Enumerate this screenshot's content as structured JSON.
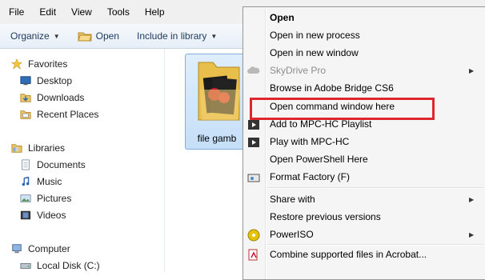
{
  "menubar": {
    "items": [
      "File",
      "Edit",
      "View",
      "Tools",
      "Help"
    ]
  },
  "commandbar": {
    "organize": "Organize",
    "open": "Open",
    "include": "Include in library"
  },
  "nav": {
    "favorites": "Favorites",
    "desktop": "Desktop",
    "downloads": "Downloads",
    "recent": "Recent Places",
    "libraries": "Libraries",
    "documents": "Documents",
    "music": "Music",
    "pictures": "Pictures",
    "videos": "Videos",
    "computer": "Computer",
    "localdisk": "Local Disk (C:)"
  },
  "content": {
    "folder_label": "file gamb"
  },
  "context_menu": {
    "items": [
      {
        "label": "Open"
      },
      {
        "label": "Open in new process"
      },
      {
        "label": "Open in new window"
      },
      {
        "label": "SkyDrive Pro"
      },
      {
        "label": "Browse in Adobe Bridge CS6"
      },
      {
        "label": "Open command window here"
      },
      {
        "label": "Add to MPC-HC Playlist"
      },
      {
        "label": "Play with MPC-HC"
      },
      {
        "label": "Open PowerShell Here"
      },
      {
        "label": "Format Factory (F)"
      },
      {
        "label": "Share with"
      },
      {
        "label": "Restore previous versions"
      },
      {
        "label": "PowerISO"
      },
      {
        "label": "Combine supported files in Acrobat..."
      }
    ]
  },
  "highlight_color": "#e0262d"
}
